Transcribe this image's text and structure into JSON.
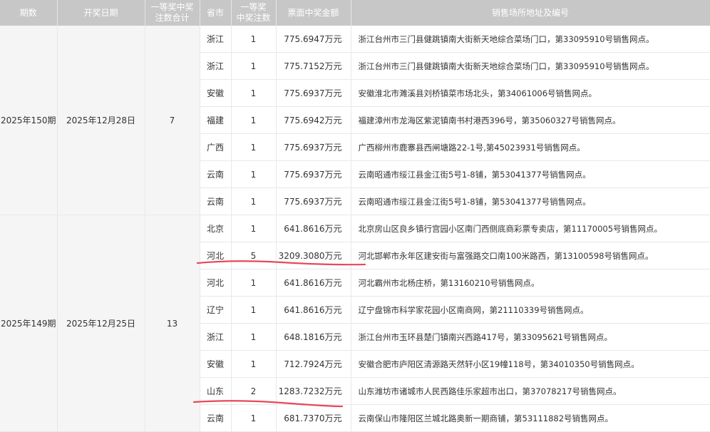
{
  "headers": {
    "issue": "期数",
    "date": "开奖日期",
    "total_line1": "一等奖中奖",
    "total_line2": "注数合计",
    "province": "省市",
    "winners_line1": "一等奖",
    "winners_line2": "中奖注数",
    "amount": "票面中奖金额",
    "address": "销售场所地址及编号"
  },
  "groups": [
    {
      "issue": "2025年150期",
      "date": "2025年12月28日",
      "total": "7",
      "rows": [
        {
          "province": "浙江",
          "count": "1",
          "amount": "775.6947万元",
          "address": "浙江台州市三门县健跳镇南大街新天地综合菜场门口，第33095910号销售网点。"
        },
        {
          "province": "浙江",
          "count": "1",
          "amount": "775.7152万元",
          "address": "浙江台州市三门县健跳镇南大街新天地综合菜场门口，第33095910号销售网点。"
        },
        {
          "province": "安徽",
          "count": "1",
          "amount": "775.6937万元",
          "address": "安徽淮北市濉溪县刘桥镇菜市场北头，第34061006号销售网点。"
        },
        {
          "province": "福建",
          "count": "1",
          "amount": "775.6942万元",
          "address": "福建漳州市龙海区紫泥镇南书村港西396号，第35060327号销售网点。"
        },
        {
          "province": "广西",
          "count": "1",
          "amount": "775.6937万元",
          "address": "广西柳州市鹿寨县西闸塘路22-1号,第45023931号销售网点。"
        },
        {
          "province": "云南",
          "count": "1",
          "amount": "775.6937万元",
          "address": "云南昭通市绥江县金江街5号1-8铺，第53041377号销售网点。"
        },
        {
          "province": "云南",
          "count": "1",
          "amount": "775.6937万元",
          "address": "云南昭通市绥江县金江街5号1-8铺，第53041377号销售网点。"
        }
      ]
    },
    {
      "issue": "2025年149期",
      "date": "2025年12月25日",
      "total": "13",
      "rows": [
        {
          "province": "北京",
          "count": "1",
          "amount": "641.8616万元",
          "address": "北京房山区良乡镇行宫园小区南门西侧底商彩票专卖店，第11170005号销售网点。"
        },
        {
          "province": "河北",
          "count": "5",
          "amount": "3209.3080万元",
          "address": "河北邯郸市永年区建安街与富强路交口南100米路西，第13100598号销售网点。"
        },
        {
          "province": "河北",
          "count": "1",
          "amount": "641.8616万元",
          "address": "河北霸州市北杨庄桥，第13160210号销售网点。"
        },
        {
          "province": "辽宁",
          "count": "1",
          "amount": "641.8616万元",
          "address": "辽宁盘锦市科学家花园小区南商网，第21110339号销售网点。"
        },
        {
          "province": "浙江",
          "count": "1",
          "amount": "648.1816万元",
          "address": "浙江台州市玉环县楚门镇南兴西路417号，第33095621号销售网点。"
        },
        {
          "province": "安徽",
          "count": "1",
          "amount": "712.7924万元",
          "address": "安徽合肥市庐阳区清源路天然轩小区19幢118号，第34010350号销售网点。"
        },
        {
          "province": "山东",
          "count": "2",
          "amount": "1283.7232万元",
          "address": "山东潍坊市诸城市人民西路佳乐家超市出口，第37078217号销售网点。"
        },
        {
          "province": "云南",
          "count": "1",
          "amount": "681.7370万元",
          "address": "云南保山市隆阳区兰城北路奥新一期商铺，第53111882号销售网点。"
        }
      ]
    }
  ],
  "annotation_color": "#e8485a"
}
